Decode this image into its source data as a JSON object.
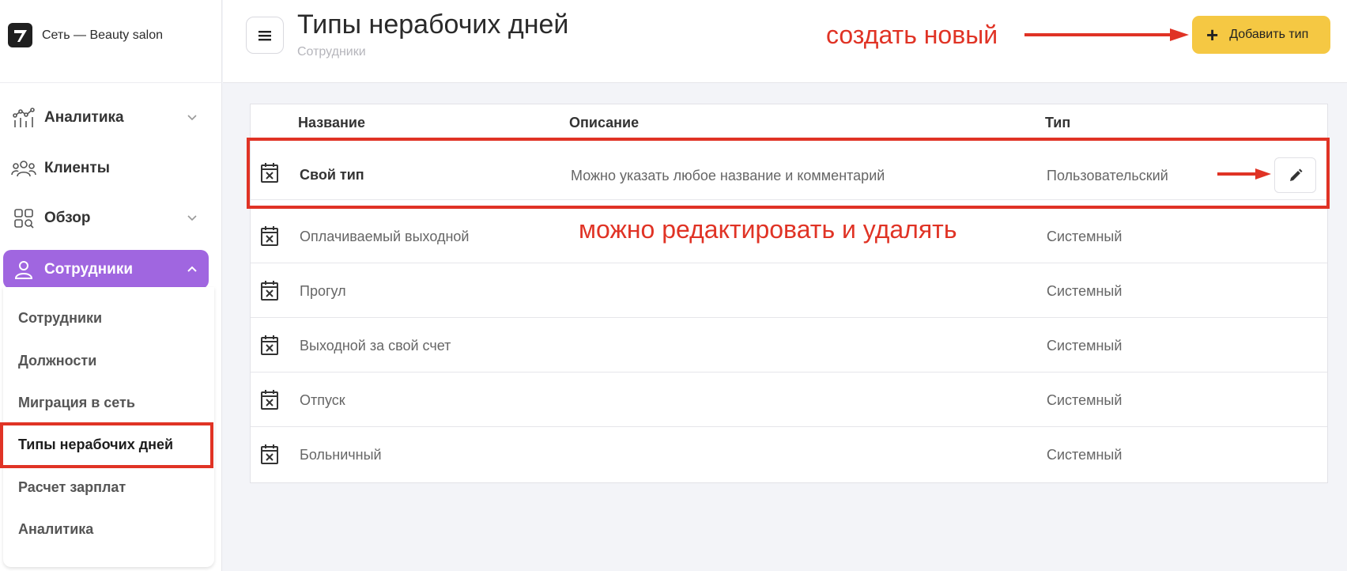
{
  "brand": {
    "name": "Сеть — Beauty salon",
    "logo_icon": "brand-logo-icon"
  },
  "sidebar": {
    "items": [
      {
        "label": "Аналитика",
        "icon": "analytics-icon",
        "expandable": true
      },
      {
        "label": "Клиенты",
        "icon": "clients-icon",
        "expandable": false
      },
      {
        "label": "Обзор",
        "icon": "overview-icon",
        "expandable": true
      },
      {
        "label": "Сотрудники",
        "icon": "employee-icon",
        "expandable": true,
        "active": true
      }
    ],
    "submenu": [
      {
        "label": "Сотрудники"
      },
      {
        "label": "Должности"
      },
      {
        "label": "Миграция в сеть"
      },
      {
        "label": "Типы нерабочих дней",
        "current": true
      },
      {
        "label": "Расчет зарплат"
      },
      {
        "label": "Аналитика"
      }
    ]
  },
  "header": {
    "title": "Типы нерабочих дней",
    "breadcrumb": "Сотрудники",
    "add_button_label": "Добавить тип"
  },
  "annotations": {
    "create": "создать новый",
    "edit": "можно редактировать и удалять",
    "color": "#e03325"
  },
  "table": {
    "columns": [
      "Название",
      "Описание",
      "Тип"
    ],
    "rows": [
      {
        "name": "Свой тип",
        "description": "Можно указать любое название и комментарий",
        "type": "Пользовательский",
        "editable": true
      },
      {
        "name": "Оплачиваемый выходной",
        "description": "",
        "type": "Системный"
      },
      {
        "name": "Прогул",
        "description": "",
        "type": "Системный"
      },
      {
        "name": "Выходной за свой счет",
        "description": "",
        "type": "Системный"
      },
      {
        "name": "Отпуск",
        "description": "",
        "type": "Системный"
      },
      {
        "name": "Больничный",
        "description": "",
        "type": "Системный"
      }
    ]
  },
  "colors": {
    "accent_purple": "#a066e0",
    "button_yellow": "#f5c843",
    "annotation_red": "#e03325"
  }
}
